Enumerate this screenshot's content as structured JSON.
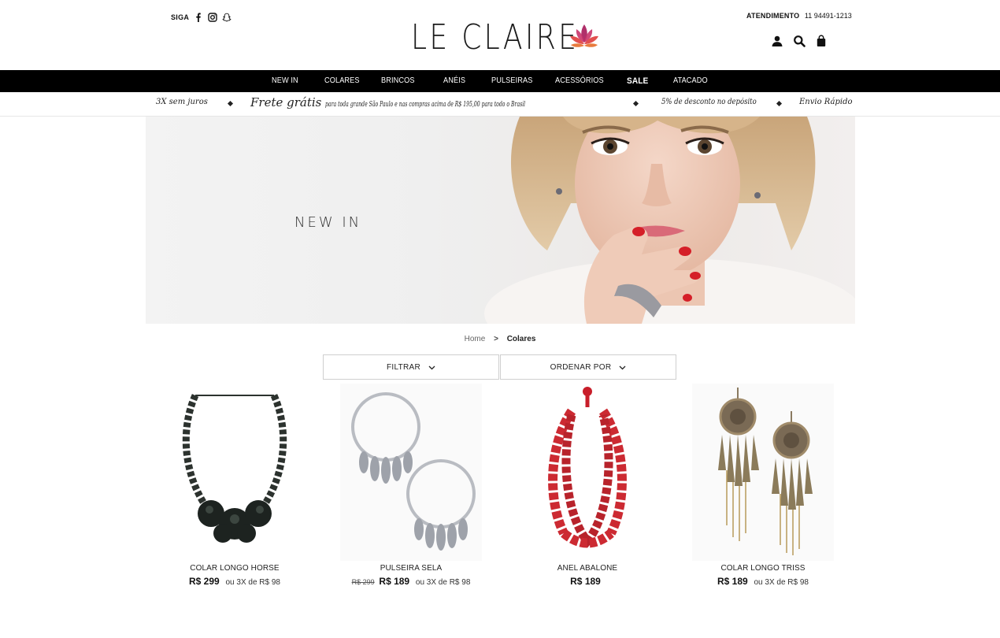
{
  "header": {
    "siga_label": "SIGA",
    "social_icons": [
      "facebook-icon",
      "instagram-icon",
      "snapchat-icon"
    ],
    "logo_text": "LE CLAIRE",
    "atendimento_label": "ATENDIMENTO",
    "atendimento_phone": "11 94491-1213",
    "actions": [
      "user-icon",
      "search-icon",
      "bag-icon"
    ]
  },
  "nav": {
    "items": [
      "NEW IN",
      "COLARES",
      "BRINCOS",
      "ANÉIS",
      "PULSEIRAS",
      "ACESSÓRIOS",
      "SALE",
      "ATACADO"
    ]
  },
  "promo": {
    "installments": "3X sem juros",
    "frete_big": "Frete grátis",
    "frete_small": "para toda grande São Paulo e nas compras acima de R$ 195,00 para todo o Brasil",
    "discount": "5% de desconto no depósito",
    "shipping": "Envio Rápido"
  },
  "hero": {
    "title": "NEW IN"
  },
  "breadcrumb": {
    "home": "Home",
    "separator": ">",
    "current": "Colares"
  },
  "filters": {
    "filter_label": "FILTRAR",
    "sort_label": "ORDENAR POR"
  },
  "products": [
    {
      "name": "COLAR LONGO HORSE",
      "old_price": "",
      "price": "R$ 299",
      "installments": "ou 3X de R$ 98"
    },
    {
      "name": "PULSEIRA SELA",
      "old_price": "R$ 299",
      "price": "R$ 189",
      "installments": "ou 3X de R$ 98"
    },
    {
      "name": "ANEL ABALONE",
      "old_price": "",
      "price": "R$ 189",
      "installments": ""
    },
    {
      "name": "COLAR LONGO TRISS",
      "old_price": "",
      "price": "R$ 189",
      "installments": "ou 3X de R$ 98"
    }
  ],
  "colors": {
    "nav_bg": "#000000",
    "lotus_dark": "#b0306a",
    "lotus_light": "#e87b3e",
    "accent_red": "#c81e2a"
  }
}
